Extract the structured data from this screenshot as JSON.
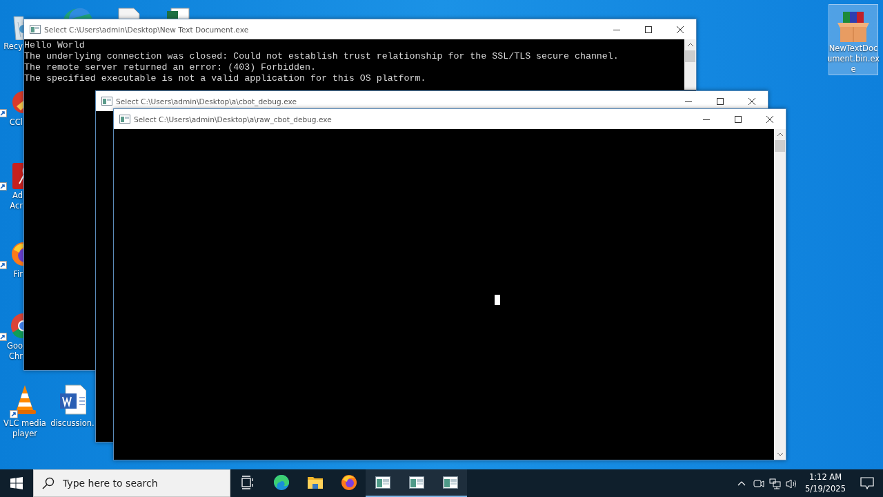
{
  "desktop_icons": [
    {
      "kind": "recycle",
      "label_lines": [
        "Recy"
      ],
      "shortcut": false,
      "selected": false
    },
    {
      "kind": "ccleaner",
      "label_lines": [
        "CCl"
      ],
      "shortcut": true,
      "selected": false
    },
    {
      "kind": "acrobat",
      "label_lines": [
        "Ad",
        "Acr"
      ],
      "shortcut": true,
      "selected": false
    },
    {
      "kind": "firefox",
      "label_lines": [
        "Fir"
      ],
      "shortcut": true,
      "selected": false
    },
    {
      "kind": "chrome",
      "label_lines": [
        "Goo",
        "Chr"
      ],
      "shortcut": true,
      "selected": false
    },
    {
      "kind": "vlc",
      "label_lines": [
        "VLC media",
        "player"
      ],
      "shortcut": true,
      "selected": false
    },
    {
      "kind": "word",
      "label_lines": [
        "discussion."
      ],
      "shortcut": false,
      "selected": false
    },
    {
      "kind": "archive",
      "label_lines": [
        "NewTextDoc",
        "ument.bin.ex",
        "e"
      ],
      "shortcut": false,
      "selected": true
    }
  ],
  "windows": [
    {
      "title": "Select C:\\Users\\admin\\Desktop\\New Text Document.exe",
      "lines": [
        "Hello World",
        "The underlying connection was closed: Could not establish trust relationship for the SSL/TLS secure channel.",
        "The remote server returned an error: (403) Forbidden.",
        "The specified executable is not a valid application for this OS platform."
      ]
    },
    {
      "title": "Select C:\\Users\\admin\\Desktop\\a\\cbot_debug.exe"
    },
    {
      "title": "Select C:\\Users\\admin\\Desktop\\a\\raw_cbot_debug.exe",
      "cursor": true
    }
  ],
  "taskbar": {
    "search": {
      "placeholder": "Type here to search"
    },
    "apps": [
      {
        "kind": "taskview",
        "running": false
      },
      {
        "kind": "edge",
        "running": false
      },
      {
        "kind": "folder",
        "running": false
      },
      {
        "kind": "firefox",
        "running": false
      },
      {
        "kind": "console",
        "running": true
      },
      {
        "kind": "console",
        "running": true
      },
      {
        "kind": "console",
        "running": true
      }
    ],
    "clock": {
      "time": "1:12 AM",
      "date": "5/19/2025"
    }
  }
}
